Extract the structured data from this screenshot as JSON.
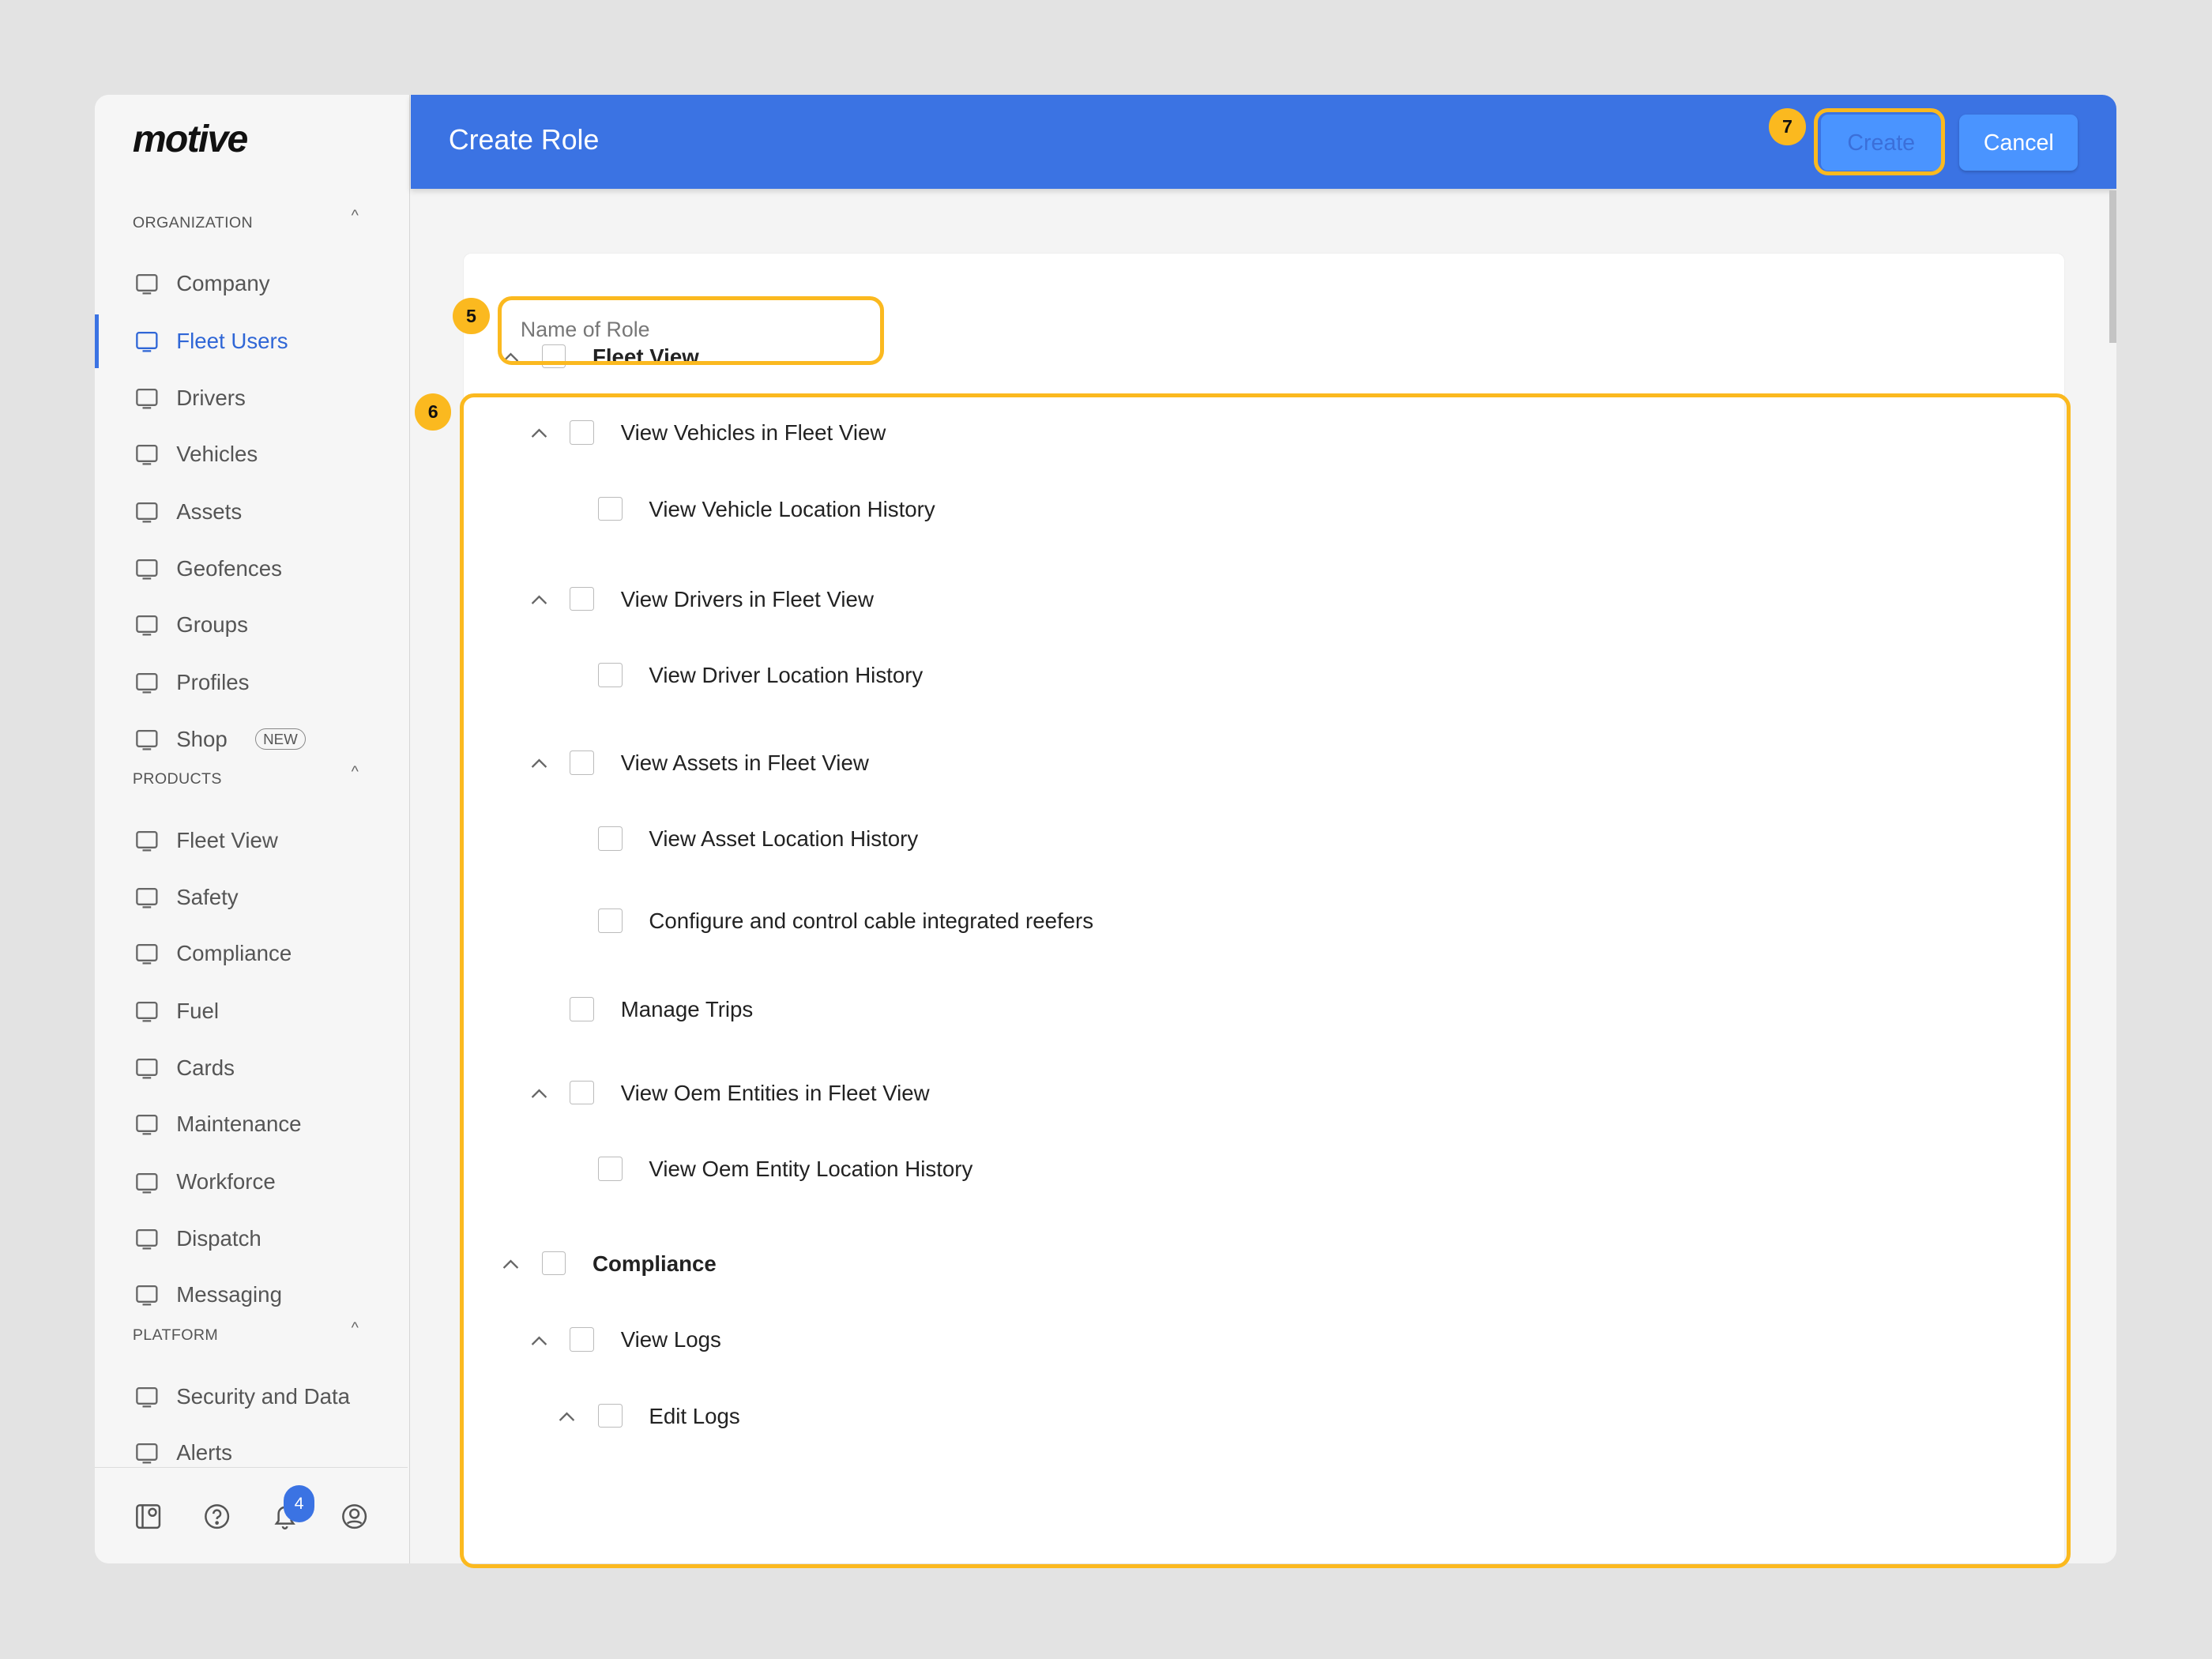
{
  "brand": "motive",
  "sidebar": {
    "sections": [
      {
        "label": "ORGANIZATION",
        "items": [
          {
            "label": "Company",
            "icon": "building-icon"
          },
          {
            "label": "Fleet Users",
            "icon": "monitor-icon",
            "active": true
          },
          {
            "label": "Drivers",
            "icon": "person-icon"
          },
          {
            "label": "Vehicles",
            "icon": "truck-icon"
          },
          {
            "label": "Assets",
            "icon": "trailer-icon"
          },
          {
            "label": "Geofences",
            "icon": "geofence-icon"
          },
          {
            "label": "Groups",
            "icon": "group-icon"
          },
          {
            "label": "Profiles",
            "icon": "profile-gear-icon"
          },
          {
            "label": "Shop",
            "icon": "shopping-bag-icon",
            "badge": "NEW"
          }
        ]
      },
      {
        "label": "PRODUCTS",
        "items": [
          {
            "label": "Fleet View",
            "icon": "map-icon"
          },
          {
            "label": "Safety",
            "icon": "shield-icon"
          },
          {
            "label": "Compliance",
            "icon": "chart-icon"
          },
          {
            "label": "Fuel",
            "icon": "fuel-icon"
          },
          {
            "label": "Cards",
            "icon": "card-icon"
          },
          {
            "label": "Maintenance",
            "icon": "wrench-icon"
          },
          {
            "label": "Workforce",
            "icon": "person-icon"
          },
          {
            "label": "Dispatch",
            "icon": "dispatch-icon"
          },
          {
            "label": "Messaging",
            "icon": "chat-icon"
          }
        ]
      },
      {
        "label": "PLATFORM",
        "items": [
          {
            "label": "Security and Data",
            "icon": "shield-lock-icon"
          },
          {
            "label": "Alerts",
            "icon": "alerts-icon"
          }
        ]
      }
    ],
    "footer": {
      "notification_count": "4"
    }
  },
  "header": {
    "title": "Create Role",
    "create_label": "Create",
    "cancel_label": "Cancel"
  },
  "form": {
    "name_placeholder": "Name of Role",
    "name_value": ""
  },
  "annotations": {
    "name": "5",
    "permissions": "6",
    "create": "7"
  },
  "permissions": [
    {
      "label": "Fleet View",
      "level": 0,
      "expandable": true,
      "checked": false
    },
    {
      "label": "View Vehicles in Fleet View",
      "level": 1,
      "expandable": true,
      "checked": false
    },
    {
      "label": "View Vehicle Location History",
      "level": 2,
      "expandable": false,
      "checked": false
    },
    {
      "label": "View Drivers in Fleet View",
      "level": 1,
      "expandable": true,
      "checked": false
    },
    {
      "label": "View Driver Location History",
      "level": 2,
      "expandable": false,
      "checked": false
    },
    {
      "label": "View Assets in Fleet View",
      "level": 1,
      "expandable": true,
      "checked": false
    },
    {
      "label": "View Asset Location History",
      "level": 2,
      "expandable": false,
      "checked": false
    },
    {
      "label": "Configure and control cable integrated reefers",
      "level": 2,
      "expandable": false,
      "checked": false
    },
    {
      "label": "Manage Trips",
      "level": 1,
      "expandable": false,
      "checked": false
    },
    {
      "label": "View Oem Entities in Fleet View",
      "level": 1,
      "expandable": true,
      "checked": false
    },
    {
      "label": "View Oem Entity Location History",
      "level": 2,
      "expandable": false,
      "checked": false
    },
    {
      "label": "Compliance",
      "level": 0,
      "expandable": true,
      "checked": false
    },
    {
      "label": "View Logs",
      "level": 1,
      "expandable": true,
      "checked": false
    },
    {
      "label": "Edit Logs",
      "level": 2,
      "expandable": true,
      "checked": false
    }
  ]
}
